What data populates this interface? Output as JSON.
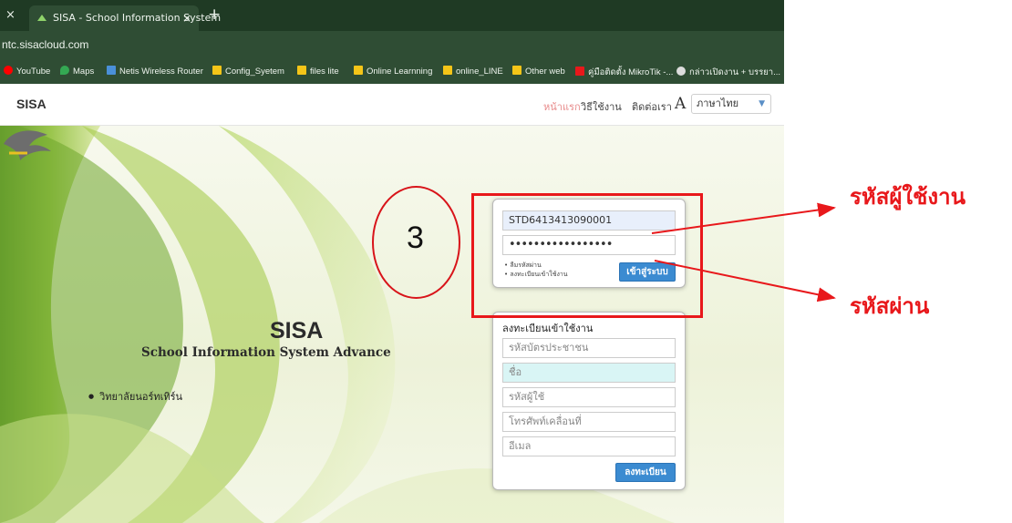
{
  "browser": {
    "tab_title": "SISA - School Information System",
    "tab_close": "×",
    "new_tab": "+",
    "url": "ntc.sisacloud.com"
  },
  "bookmarks": [
    {
      "label": "YouTube",
      "color": "#ff0000"
    },
    {
      "label": "Maps",
      "color": "#34a853"
    },
    {
      "label": "Netis Wireless Router",
      "color": "#4a90d9"
    },
    {
      "label": "Config_Syetem",
      "color": "#f5c518"
    },
    {
      "label": "files lite",
      "color": "#f5c518"
    },
    {
      "label": "Online Learnning",
      "color": "#f5c518"
    },
    {
      "label": "online_LINE",
      "color": "#f5c518"
    },
    {
      "label": "Other web",
      "color": "#f5c518"
    },
    {
      "label": "คู่มือติดตั้ง MikroTik -...",
      "color": "#e8181b"
    },
    {
      "label": "กล่าวเปิดงาน + บรรยา...",
      "color": "#dddddd"
    }
  ],
  "header": {
    "brand": "SISA",
    "nav": [
      "หน้าแรก",
      "วิธีใช้งาน",
      "ติดต่อเรา"
    ],
    "font_icon": "A",
    "language": "ภาษาไทย"
  },
  "hero": {
    "logo_text": "SISA",
    "subtitle": "School Information System Advance",
    "school": "วิทยาลัยนอร์ทเทิร์น"
  },
  "login": {
    "username": "STD6413413090001",
    "password": "•••••••••••••••••",
    "links": [
      "ลืมรหัสผ่าน",
      "ลงทะเบียนเข้าใช้งาน"
    ],
    "submit": "เข้าสู่ระบบ"
  },
  "register": {
    "title": "ลงทะเบียนเข้าใช้งาน",
    "placeholders": [
      "รหัสบัตรประชาชน",
      "ชื่อ",
      "รหัสผู้ใช้",
      "โทรศัพท์เคลื่อนที่",
      "อีเมล"
    ],
    "submit": "ลงทะเบียน"
  },
  "annotation": {
    "step": "3",
    "username_label": "รหัสผู้ใช้งาน",
    "password_label": "รหัสผ่าน",
    "color": "#e8181b"
  }
}
